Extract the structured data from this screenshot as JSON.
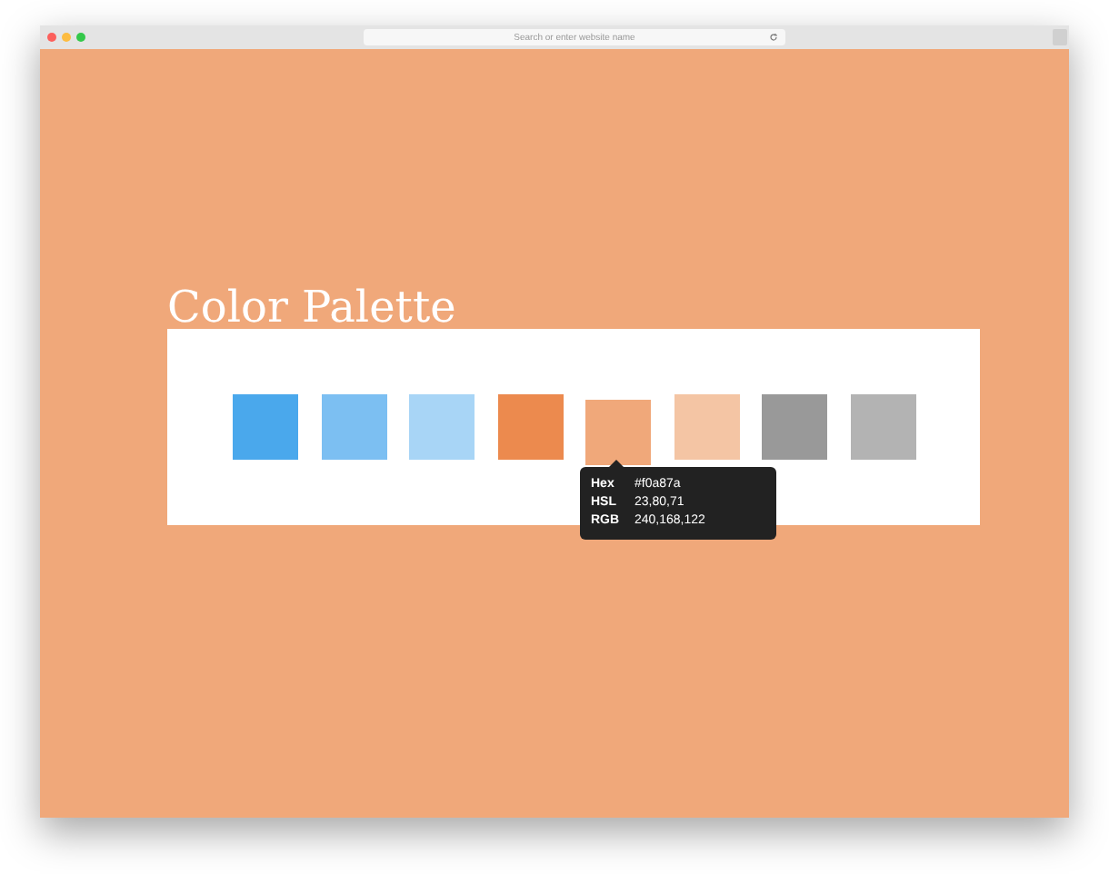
{
  "browser": {
    "search_placeholder": "Search or enter website name"
  },
  "title": "Color Palette",
  "swatches": [
    {
      "color": "#4aa8ec",
      "selected": false
    },
    {
      "color": "#7cbff2",
      "selected": false
    },
    {
      "color": "#a8d5f6",
      "selected": false
    },
    {
      "color": "#ec8a4e",
      "selected": false
    },
    {
      "color": "#f0a87a",
      "selected": true
    },
    {
      "color": "#f4c5a4",
      "selected": false
    },
    {
      "color": "#999999",
      "selected": false
    },
    {
      "color": "#b3b3b3",
      "selected": false
    }
  ],
  "tooltip": [
    {
      "label": "Hex",
      "value": "#f0a87a"
    },
    {
      "label": "HSL",
      "value": "23,80,71"
    },
    {
      "label": "RGB",
      "value": "240,168,122"
    }
  ]
}
